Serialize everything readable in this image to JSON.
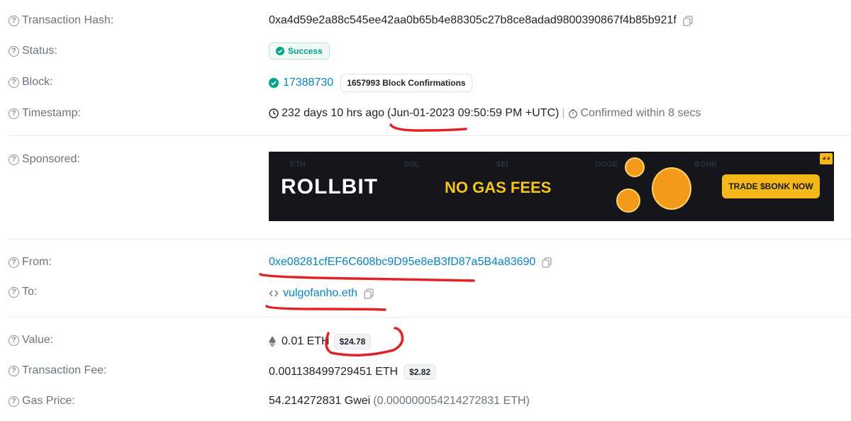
{
  "labels": {
    "transaction_hash": "Transaction Hash:",
    "status": "Status:",
    "block": "Block:",
    "timestamp": "Timestamp:",
    "sponsored": "Sponsored:",
    "from": "From:",
    "to": "To:",
    "value": "Value:",
    "transaction_fee": "Transaction Fee:",
    "gas_price": "Gas Price:"
  },
  "help_glyph": "?",
  "tx": {
    "hash": "0xa4d59e2a88c545ee42aa0b65b4e88305c27b8ce8adad9800390867f4b85b921f",
    "status": "Success",
    "block_number": "17388730",
    "block_confirmations": "1657993 Block Confirmations",
    "timestamp_age": "232 days 10 hrs ago",
    "timestamp_date": "(Jun-01-2023 09:50:59 PM +UTC)",
    "separator": "|",
    "confirmed_within": "Confirmed within 8 secs",
    "from_address": "0xe08281cfEF6C608bc9D95e8eB3fD87a5B4a83690",
    "to_name": "vulgofanho.eth",
    "value_eth": "0.01 ETH",
    "value_usd": "$24.78",
    "fee_eth": "0.001138499729451 ETH",
    "fee_usd": "$2.82",
    "gas_price_gwei": "54.214272831 Gwei",
    "gas_price_eth": "(0.000000054214272831 ETH)"
  },
  "ad": {
    "brand": "ROLLBIT",
    "headline": "NO GAS FEES",
    "cta": "TRADE $BONK NOW"
  },
  "colors": {
    "link": "#0784c3",
    "success_green": "#00a186",
    "annotation_red": "#e02424",
    "ad_background": "#14161c",
    "ad_yellow": "#f5c518"
  },
  "icons": [
    "help-circle-icon",
    "copy-icon",
    "check-circle-icon",
    "clock-icon",
    "stopwatch-icon",
    "contract-code-icon",
    "ethereum-icon"
  ]
}
